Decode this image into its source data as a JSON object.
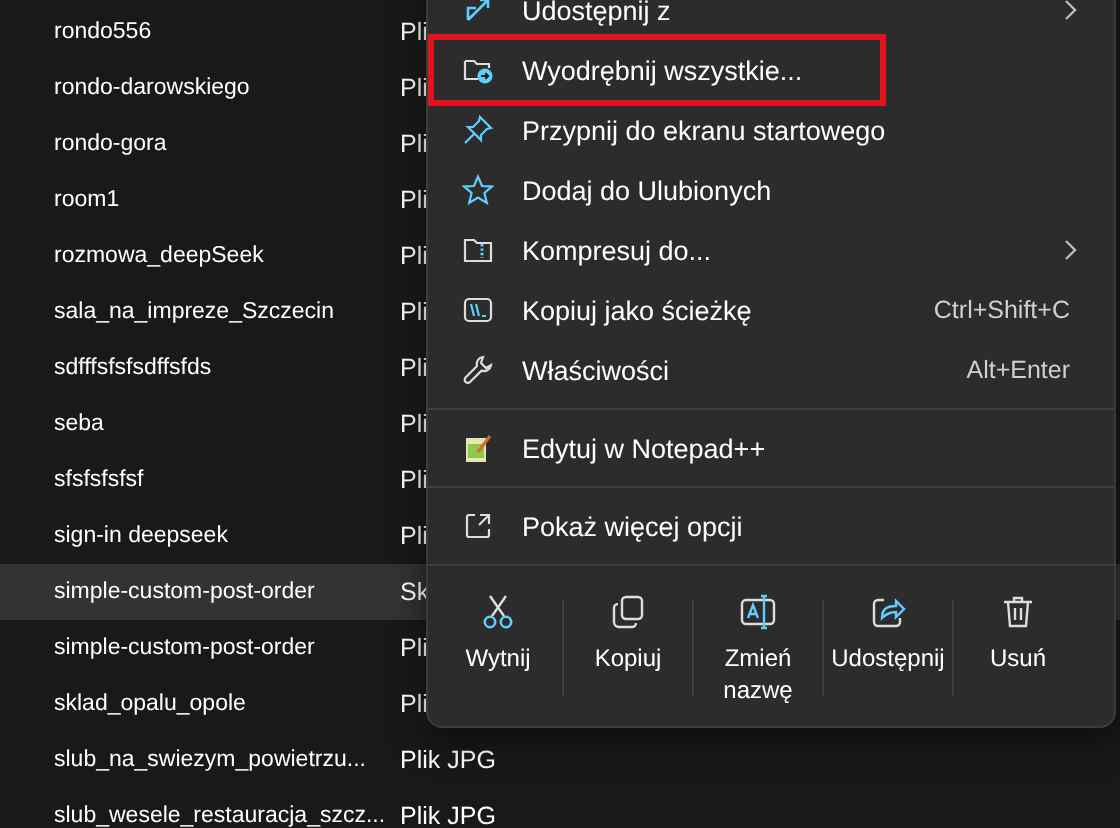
{
  "files": [
    {
      "name": "rondo556",
      "type": "Pli",
      "selected": false
    },
    {
      "name": "rondo-darowskiego",
      "type": "Pli",
      "selected": false
    },
    {
      "name": "rondo-gora",
      "type": "Pli",
      "selected": false
    },
    {
      "name": "room1",
      "type": "Pli",
      "selected": false
    },
    {
      "name": "rozmowa_deepSeek",
      "type": "Pli",
      "selected": false
    },
    {
      "name": "sala_na_impreze_Szczecin",
      "type": "Pli",
      "selected": false
    },
    {
      "name": "sdfffsfsfsdffsfds",
      "type": "Pli",
      "selected": false
    },
    {
      "name": "seba",
      "type": "Pli",
      "selected": false
    },
    {
      "name": "sfsfsfsfsf",
      "type": "Pli",
      "selected": false
    },
    {
      "name": "sign-in deepseek",
      "type": "Pli",
      "selected": false
    },
    {
      "name": "simple-custom-post-order",
      "type": "Sk",
      "selected": true
    },
    {
      "name": "simple-custom-post-order",
      "type": "Pli",
      "selected": false
    },
    {
      "name": "sklad_opalu_opole",
      "type": "Pli",
      "selected": false
    },
    {
      "name": "slub_na_swiezym_powietrzu...",
      "type": "Plik JPG",
      "selected": false
    },
    {
      "name": "slub_wesele_restauracja_szcz...",
      "type": "Plik JPG",
      "selected": false
    }
  ],
  "context_menu": {
    "items": [
      {
        "kind": "share",
        "label": "Udostępnij z",
        "submenu": true,
        "highlighted": false
      },
      {
        "kind": "extract",
        "label": "Wyodrębnij wszystkie...",
        "highlighted": true
      },
      {
        "kind": "pin",
        "label": "Przypnij do ekranu startowego",
        "highlighted": false
      },
      {
        "kind": "star",
        "label": "Dodaj do Ulubionych",
        "highlighted": false
      },
      {
        "kind": "zip",
        "label": "Kompresuj do...",
        "submenu": true,
        "highlighted": false
      },
      {
        "kind": "path",
        "label": "Kopiuj jako ścieżkę",
        "shortcut": "Ctrl+Shift+C",
        "highlighted": false
      },
      {
        "kind": "wrench",
        "label": "Właściwości",
        "shortcut": "Alt+Enter",
        "highlighted": false,
        "divider_after": true
      },
      {
        "kind": "notepad",
        "label": "Edytuj w Notepad++",
        "highlighted": false,
        "divider_after": true
      },
      {
        "kind": "more",
        "label": "Pokaż więcej opcji",
        "highlighted": false
      }
    ],
    "actions": [
      {
        "kind": "cut",
        "label": "Wytnij"
      },
      {
        "kind": "copy",
        "label": "Kopiuj"
      },
      {
        "kind": "rename",
        "label": "Zmień nazwę"
      },
      {
        "kind": "share",
        "label": "Udostępnij"
      },
      {
        "kind": "delete",
        "label": "Usuń"
      }
    ]
  }
}
